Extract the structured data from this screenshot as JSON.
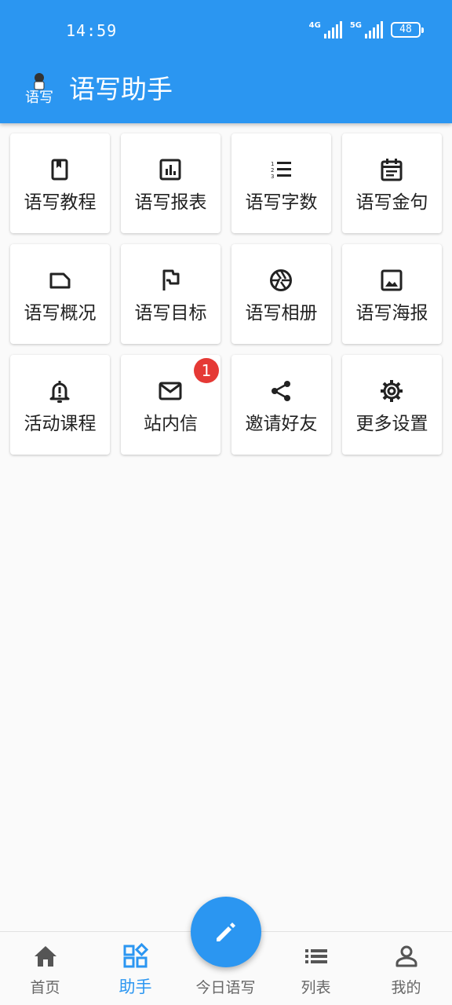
{
  "status": {
    "time": "14:59",
    "net1": "4G",
    "net2": "5G",
    "battery": "48"
  },
  "app": {
    "title": "语写助手",
    "logo_text": "语写"
  },
  "tiles": [
    {
      "label": "语写教程",
      "icon": "book-icon"
    },
    {
      "label": "语写报表",
      "icon": "bar-chart-icon"
    },
    {
      "label": "语写字数",
      "icon": "numbered-list-icon"
    },
    {
      "label": "语写金句",
      "icon": "calendar-note-icon"
    },
    {
      "label": "语写概况",
      "icon": "label-tag-icon"
    },
    {
      "label": "语写目标",
      "icon": "flag-icon"
    },
    {
      "label": "语写相册",
      "icon": "camera-shutter-icon"
    },
    {
      "label": "语写海报",
      "icon": "image-icon"
    },
    {
      "label": "活动课程",
      "icon": "bell-alert-icon"
    },
    {
      "label": "站内信",
      "icon": "mail-icon",
      "badge": "1"
    },
    {
      "label": "邀请好友",
      "icon": "share-icon"
    },
    {
      "label": "更多设置",
      "icon": "gear-icon"
    }
  ],
  "nav": {
    "home": "首页",
    "assistant": "助手",
    "today": "今日语写",
    "list": "列表",
    "mine": "我的"
  },
  "colors": {
    "primary": "#2b96f1",
    "badge": "#e53935"
  }
}
